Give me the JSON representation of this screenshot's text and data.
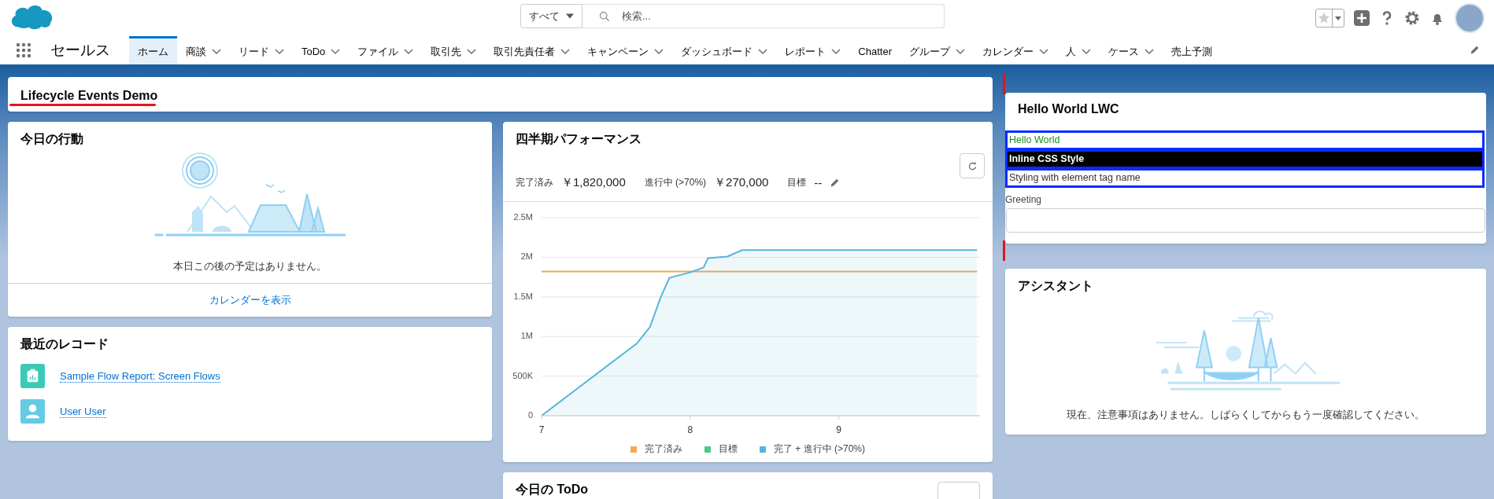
{
  "header": {
    "search_scope": "すべて",
    "search": {
      "placeholder": "検索..."
    }
  },
  "nav": {
    "app_name": "セールス",
    "items": [
      {
        "label": "ホーム",
        "selected": true,
        "has_menu": false
      },
      {
        "label": "商談",
        "selected": false,
        "has_menu": true
      },
      {
        "label": "リード",
        "selected": false,
        "has_menu": true
      },
      {
        "label": "ToDo",
        "selected": false,
        "has_menu": true
      },
      {
        "label": "ファイル",
        "selected": false,
        "has_menu": true
      },
      {
        "label": "取引先",
        "selected": false,
        "has_menu": true
      },
      {
        "label": "取引先責任者",
        "selected": false,
        "has_menu": true
      },
      {
        "label": "キャンペーン",
        "selected": false,
        "has_menu": true
      },
      {
        "label": "ダッシュボード",
        "selected": false,
        "has_menu": true
      },
      {
        "label": "レポート",
        "selected": false,
        "has_menu": true
      },
      {
        "label": "Chatter",
        "selected": false,
        "has_menu": false
      },
      {
        "label": "グループ",
        "selected": false,
        "has_menu": true
      },
      {
        "label": "カレンダー",
        "selected": false,
        "has_menu": true
      },
      {
        "label": "人",
        "selected": false,
        "has_menu": true
      },
      {
        "label": "ケース",
        "selected": false,
        "has_menu": true
      },
      {
        "label": "売上予測",
        "selected": false,
        "has_menu": false
      }
    ]
  },
  "page_title": "Lifecycle Events Demo",
  "events_card": {
    "title": "今日の行動",
    "empty_message": "本日この後の予定はありません。",
    "footer_link": "カレンダーを表示"
  },
  "recent_records": {
    "title": "最近のレコード",
    "items": [
      {
        "kind": "report",
        "label": "Sample Flow Report: Screen Flows"
      },
      {
        "kind": "user",
        "label": "User User"
      }
    ]
  },
  "performance": {
    "title": "四半期パフォーマンス",
    "stats": [
      {
        "label": "完了済み",
        "value": "￥1,820,000"
      },
      {
        "label": "進行中 (>70%)",
        "value": "￥270,000"
      },
      {
        "label": "目標",
        "value": "--"
      }
    ],
    "chart_data": {
      "type": "line",
      "x": [
        7,
        7.64,
        7.73,
        7.8,
        7.86,
        8,
        8.09,
        8.12,
        8.25,
        8.35,
        9.93
      ],
      "xlim": [
        7,
        9.95
      ],
      "grid": true,
      "legend": true,
      "ylim": [
        0,
        2500000
      ],
      "xticks": [
        7,
        8,
        9
      ],
      "yticks": [
        {
          "value": 0,
          "label": "0"
        },
        {
          "value": 500000,
          "label": "500K"
        },
        {
          "value": 1000000,
          "label": "1M"
        },
        {
          "value": 1500000,
          "label": "1.5M"
        },
        {
          "value": 2000000,
          "label": "2M"
        },
        {
          "value": 2500000,
          "label": "2.5M"
        }
      ],
      "series": [
        {
          "name": "完了済み",
          "color": "#f4a853",
          "values": [
            1820000,
            1820000,
            1820000,
            1820000,
            1820000,
            1820000,
            1820000,
            1820000,
            1820000,
            1820000,
            1820000
          ]
        },
        {
          "name": "目標",
          "color": "#4bca81",
          "values": [
            null,
            null,
            null,
            null,
            null,
            null,
            null,
            null,
            null,
            null,
            null
          ]
        },
        {
          "name": "完了 + 進行中 (>70%)",
          "color": "#54b6d9",
          "values": [
            0,
            910000,
            1120000,
            1490000,
            1740000,
            1810000,
            1870000,
            1990000,
            2010000,
            2090000,
            2090000
          ]
        }
      ]
    }
  },
  "todo_card": {
    "title": "今日の ToDo"
  },
  "hello_card": {
    "title": "Hello World LWC",
    "lines": [
      {
        "kind": "green",
        "text": "Hello World"
      },
      {
        "kind": "inverse",
        "text": "Inline CSS Style"
      },
      {
        "kind": "plain",
        "text": "Styling with element tag name"
      }
    ],
    "greeting_label": "Greeting"
  },
  "assistant": {
    "title": "アシスタント",
    "message": "現在、注意事項はありません。しばらくしてからもう一度確認してください。"
  }
}
